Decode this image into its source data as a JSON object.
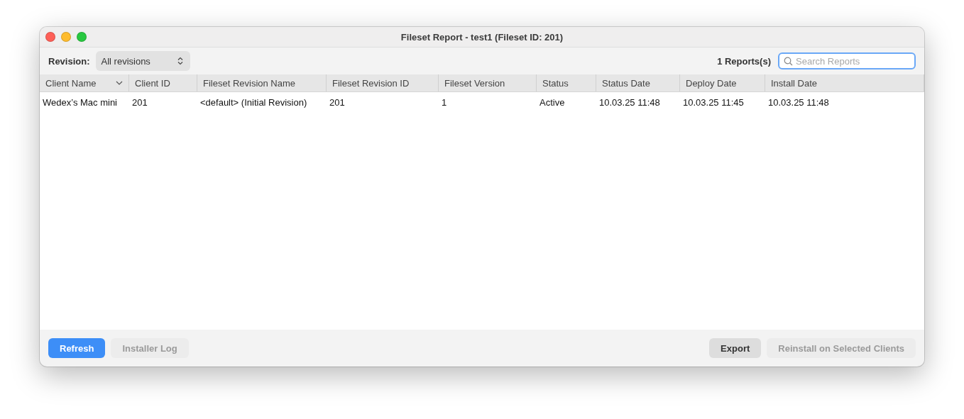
{
  "window": {
    "title": "Fileset Report - test1 (Fileset ID: 201)"
  },
  "toolbar": {
    "revision_label": "Revision:",
    "revision_value": "All revisions",
    "report_count": "1 Reports(s)",
    "search": {
      "placeholder": "Search Reports"
    }
  },
  "table": {
    "columns": [
      {
        "label": "Client Name",
        "sorted": true
      },
      {
        "label": "Client ID",
        "sorted": false
      },
      {
        "label": "Fileset Revision Name",
        "sorted": false
      },
      {
        "label": "Fileset Revision ID",
        "sorted": false
      },
      {
        "label": "Fileset Version",
        "sorted": false
      },
      {
        "label": "Status",
        "sorted": false
      },
      {
        "label": "Status Date",
        "sorted": false
      },
      {
        "label": "Deploy Date",
        "sorted": false
      },
      {
        "label": "Install Date",
        "sorted": false
      }
    ],
    "rows": [
      [
        "Wedex’s Mac mini",
        "201",
        "<default> (Initial Revision)",
        "201",
        "1",
        "Active",
        "10.03.25 11:48",
        "10.03.25 11:45",
        "10.03.25 11:48"
      ]
    ]
  },
  "footer": {
    "left_buttons": [
      {
        "label": "Refresh",
        "kind": "primary",
        "disabled": false
      },
      {
        "label": "Installer Log",
        "kind": "plain",
        "disabled": true
      }
    ],
    "right_buttons": [
      {
        "label": "Export",
        "kind": "plain",
        "disabled": false
      },
      {
        "label": "Reinstall on Selected Clients",
        "kind": "plain",
        "disabled": true
      }
    ]
  }
}
